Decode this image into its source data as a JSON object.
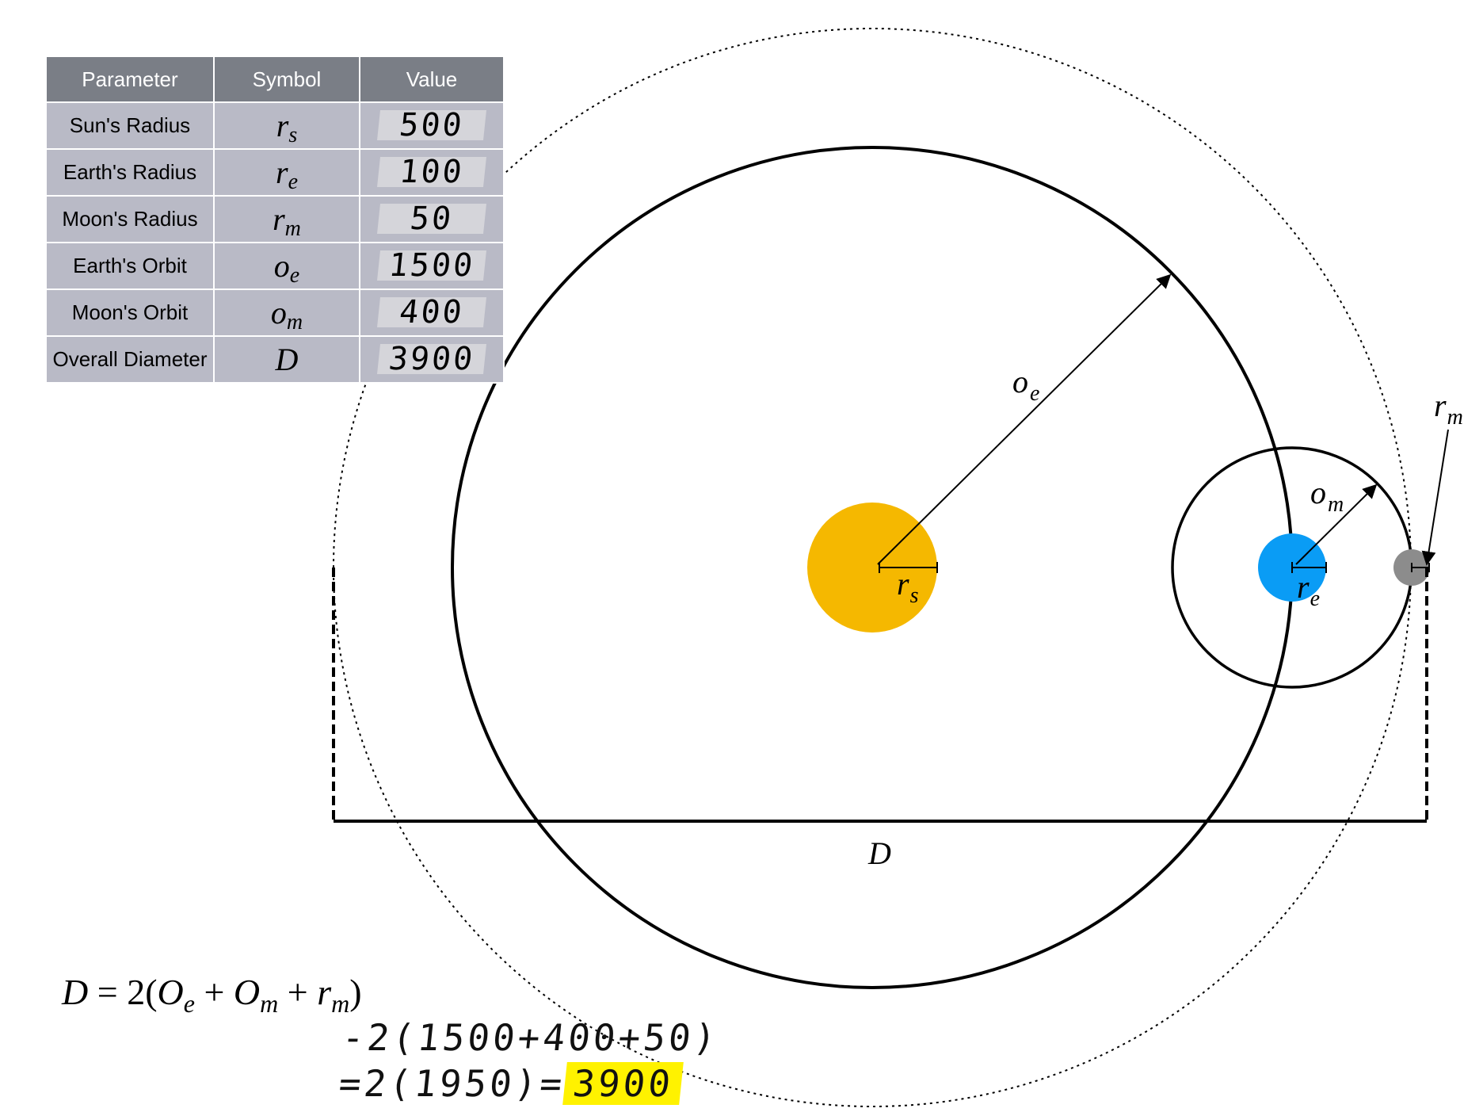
{
  "table": {
    "headers": {
      "parameter": "Parameter",
      "symbol": "Symbol",
      "value": "Value"
    },
    "rows": [
      {
        "parameter": "Sun's Radius",
        "symbol_base": "r",
        "symbol_sub": "s",
        "value": "500"
      },
      {
        "parameter": "Earth's Radius",
        "symbol_base": "r",
        "symbol_sub": "e",
        "value": "100"
      },
      {
        "parameter": "Moon's Radius",
        "symbol_base": "r",
        "symbol_sub": "m",
        "value": "50"
      },
      {
        "parameter": "Earth's Orbit",
        "symbol_base": "o",
        "symbol_sub": "e",
        "value": "1500"
      },
      {
        "parameter": "Moon's Orbit",
        "symbol_base": "o",
        "symbol_sub": "m",
        "value": "400"
      },
      {
        "parameter": "Overall Diameter",
        "symbol_base": "D",
        "symbol_sub": "",
        "value": "3900"
      }
    ]
  },
  "diagram": {
    "labels": {
      "earth_orbit": {
        "base": "o",
        "sub": "e"
      },
      "moon_orbit": {
        "base": "o",
        "sub": "m"
      },
      "sun_radius": {
        "base": "r",
        "sub": "s"
      },
      "earth_radius": {
        "base": "r",
        "sub": "e"
      },
      "moon_radius": {
        "base": "r",
        "sub": "m"
      },
      "diameter": "D"
    },
    "colors": {
      "sun": "#f5b800",
      "earth": "#0a9cf5",
      "moon": "#8c8c8c",
      "highlight": "#fff200"
    }
  },
  "formula": {
    "lhs": "D",
    "eq": "=",
    "coef": "2(",
    "t1_base": "O",
    "t1_sub": "e",
    "plus1": "+",
    "t2_base": "O",
    "t2_sub": "m",
    "plus2": "+",
    "t3_base": "r",
    "t3_sub": "m",
    "close": ")"
  },
  "handwriting": {
    "line1": "-2(1500+400+50)",
    "line2_prefix": "=2(1950)=",
    "line2_result": "3900"
  }
}
